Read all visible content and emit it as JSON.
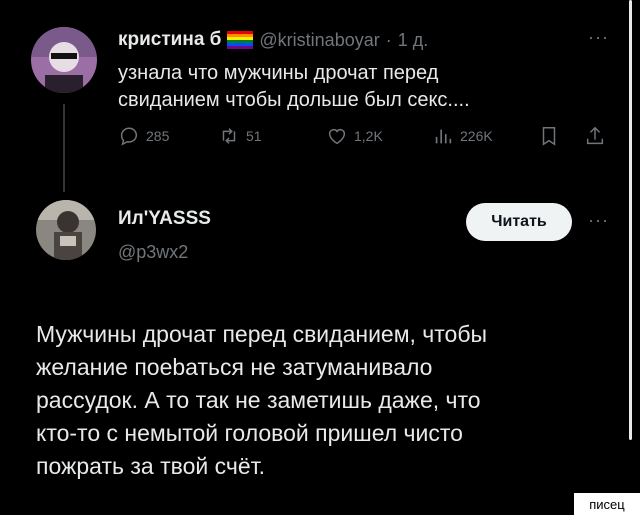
{
  "tweet1": {
    "author_name": "кристина б",
    "handle": "@kristinaboyar",
    "separator": "·",
    "time": "1 д.",
    "more": "···",
    "text_line1": "узнала что мужчины дрочат перед",
    "text_line2": "свиданием чтобы дольше был секс....",
    "actions": {
      "replies": "285",
      "reposts": "51",
      "likes": "1,2K",
      "views": "226K"
    }
  },
  "tweet2": {
    "author_name": "Ил'YASSS",
    "handle": "@p3wx2",
    "read_button": "Читать",
    "more": "···",
    "body_lines": [
      "Мужчины дрочат перед свиданием, чтобы",
      "желание поеbаться не затуманивало",
      "рассудок. А то так не заметишь даже, что",
      "кто-то с немытой головой пришел чисто",
      "пожрать за твой счёт."
    ]
  },
  "watermark": "писец",
  "colors": {
    "background": "#000000",
    "text": "#e7e9ea",
    "muted": "#71767b",
    "button_bg": "#eff3f4"
  },
  "icons": [
    "reply-icon",
    "repost-icon",
    "like-icon",
    "views-icon",
    "bookmark-icon",
    "share-icon",
    "pride-flag-icon"
  ]
}
